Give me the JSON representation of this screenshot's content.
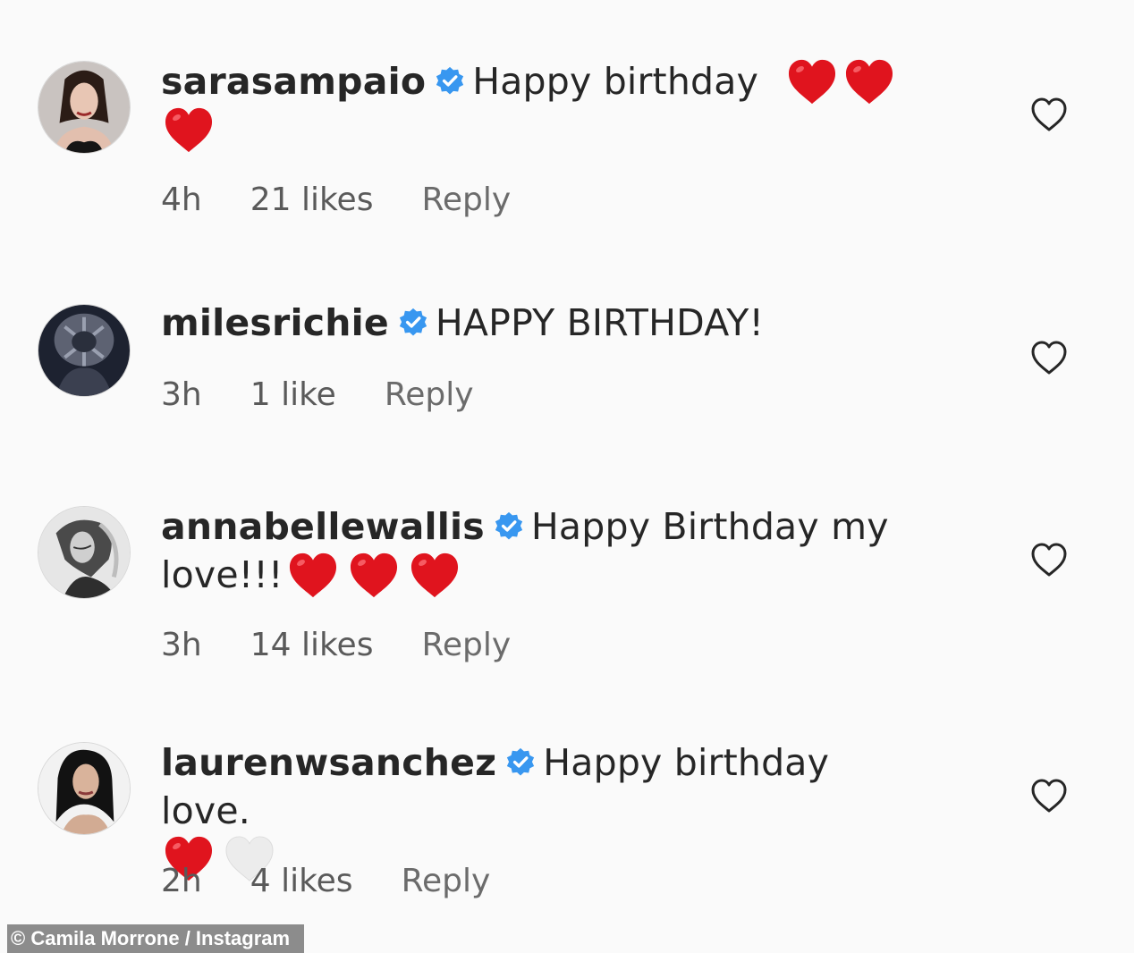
{
  "comments": [
    {
      "username": "sarasampaio",
      "text": "Happy birthday",
      "hearts": [
        "red",
        "red",
        "red"
      ],
      "time": "4h",
      "likes": "21 likes",
      "reply": "Reply"
    },
    {
      "username": "milesrichie",
      "text": "HAPPY BIRTHDAY!",
      "hearts": [],
      "time": "3h",
      "likes": "1 like",
      "reply": "Reply"
    },
    {
      "username": "annabellewallis",
      "text": "Happy Birthday my love!!!",
      "hearts": [
        "red",
        "red",
        "red"
      ],
      "time": "3h",
      "likes": "14 likes",
      "reply": "Reply"
    },
    {
      "username": "laurenwsanchez",
      "text": "Happy birthday love.",
      "hearts": [
        "red",
        "white"
      ],
      "time": "2h",
      "likes": "4 likes",
      "reply": "Reply"
    }
  ],
  "credit": "© Camila Morrone / Instagram",
  "colors": {
    "verified": "#3897f0",
    "heart_red": "#e0141e",
    "heart_white": "#ececec",
    "meta_text": "#5a5a5a"
  },
  "icons": {
    "verified": "verified-badge-icon",
    "like": "heart-outline-icon"
  }
}
